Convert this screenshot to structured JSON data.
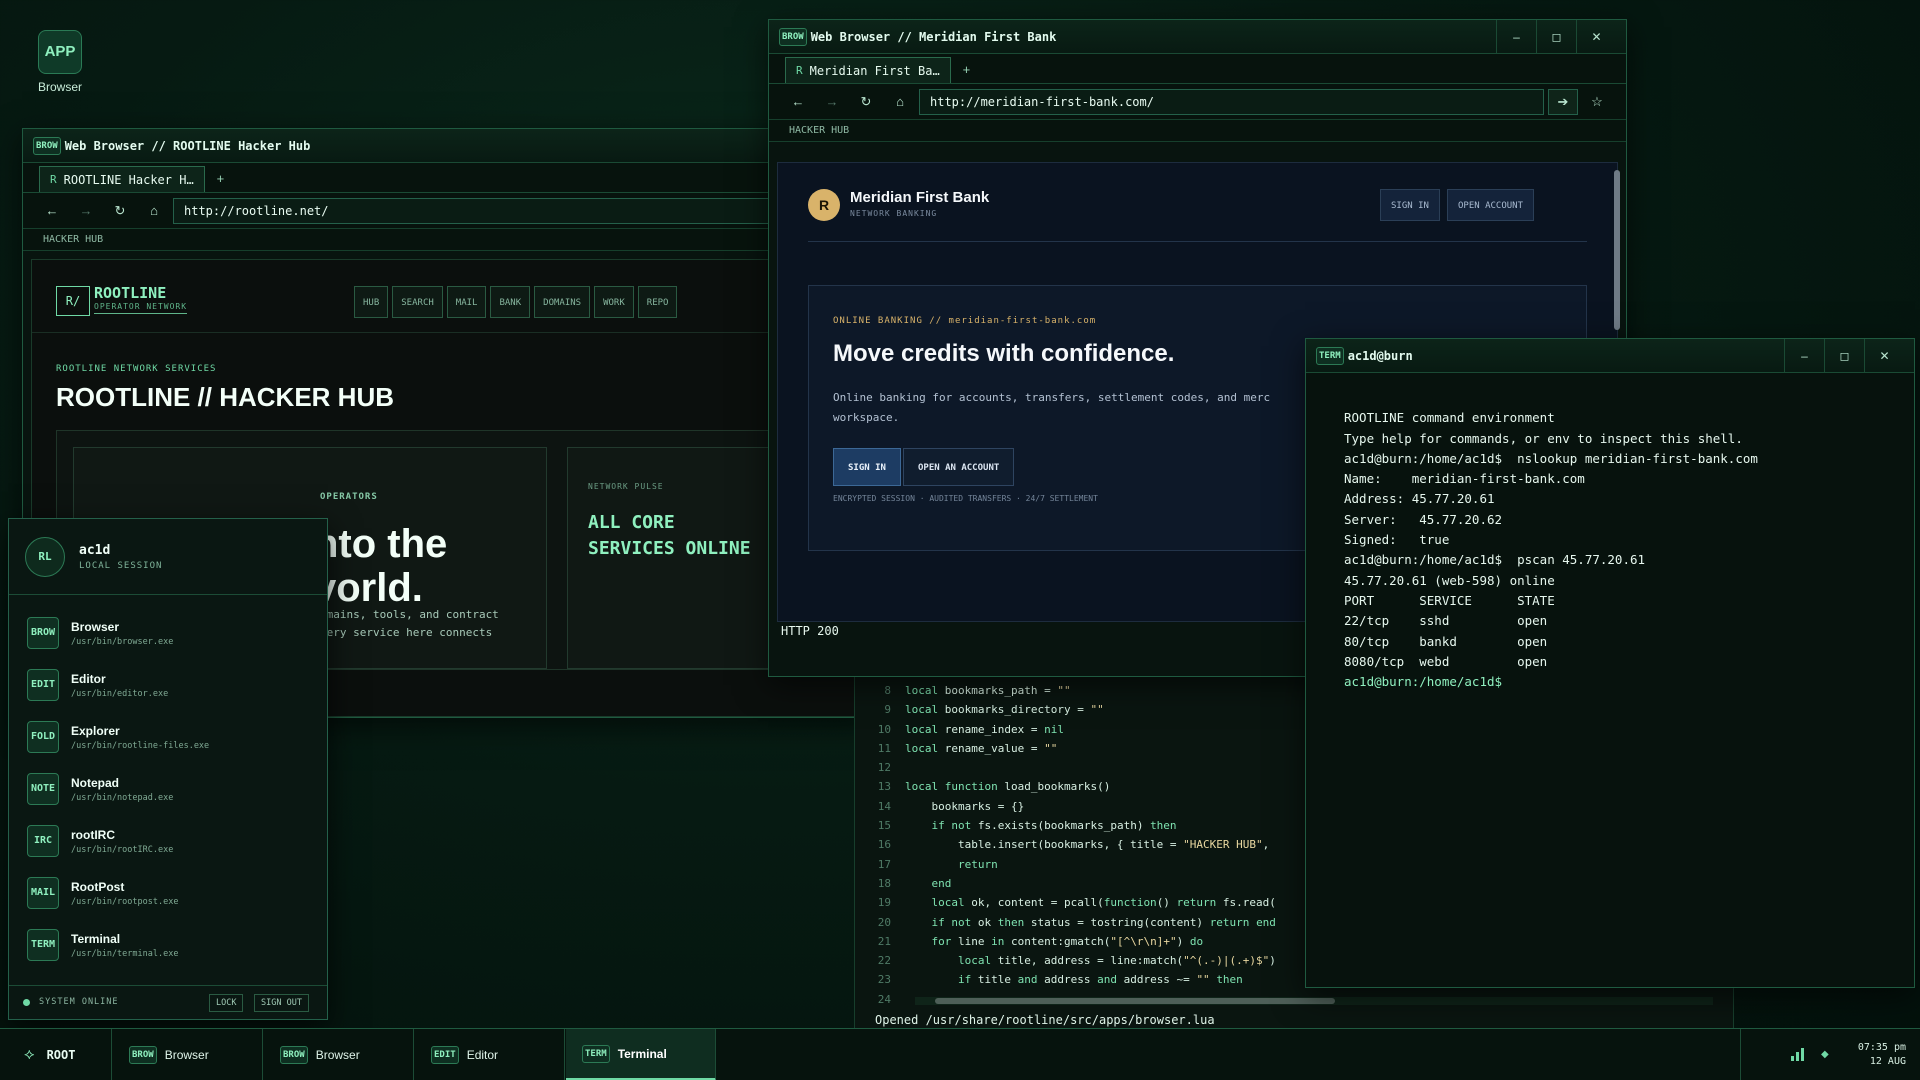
{
  "desktop": {
    "icon_tile": "APP",
    "icon_label": "Browser"
  },
  "rootline_window": {
    "badge": "BROW",
    "title": "Web Browser // ROOTLINE Hacker Hub",
    "tab_label": "ROOTLINE Hacker H…",
    "tab_icon": "R",
    "tab_add": "+",
    "url": "http://rootline.net/",
    "crumb": "HACKER HUB",
    "logo": "R/",
    "brand": "ROOTLINE",
    "brand_sub": "OPERATOR NETWORK",
    "nav": [
      "HUB",
      "SEARCH",
      "MAIL",
      "BANK",
      "DOMAINS",
      "WORK",
      "REPO"
    ],
    "kicker": "ROOTLINE NETWORK SERVICES",
    "heading": "ROOTLINE // HACKER HUB",
    "card_kicker": "OPERATORS",
    "card_big_1": "nto the",
    "card_big_2": "vorld.",
    "card_body_1": "omains, tools, and contract",
    "card_body_2": "very service here connects",
    "pulse_kicker": "NETWORK PULSE",
    "pulse_1": "ALL CORE",
    "pulse_2": "SERVICES ONLINE"
  },
  "bank_window": {
    "badge": "BROW",
    "title": "Web Browser // Meridian First Bank",
    "tab_label": "Meridian First Ba…",
    "tab_icon": "R",
    "tab_add": "+",
    "url": "http://meridian-first-bank.com/",
    "crumb": "HACKER HUB",
    "logo": "R",
    "name": "Meridian First Bank",
    "sub": "NETWORK BANKING",
    "sign_in": "SIGN IN",
    "open_account": "OPEN ACCOUNT",
    "kicker": "ONLINE BANKING // meridian-first-bank.com",
    "hero": "Move credits with confidence.",
    "desc_1": "Online banking for accounts, transfers, settlement codes, and merc",
    "desc_2": "workspace.",
    "cta_sign_in": "SIGN IN",
    "cta_open": "OPEN AN ACCOUNT",
    "fine": "ENCRYPTED SESSION · AUDITED TRANSFERS · 24/7 SETTLEMENT",
    "status": "HTTP 200"
  },
  "editor": {
    "lines": [
      {
        "n": "8",
        "code": "local bookmarks_path = \"\""
      },
      {
        "n": "9",
        "code": "local bookmarks_directory = \"\""
      },
      {
        "n": "10",
        "code": "local rename_index = nil"
      },
      {
        "n": "11",
        "code": "local rename_value = \"\""
      },
      {
        "n": "12",
        "code": ""
      },
      {
        "n": "13",
        "code": "local function load_bookmarks()"
      },
      {
        "n": "14",
        "code": "    bookmarks = {}"
      },
      {
        "n": "15",
        "code": "    if not fs.exists(bookmarks_path) then"
      },
      {
        "n": "16",
        "code": "        table.insert(bookmarks, { title = \"HACKER HUB\","
      },
      {
        "n": "17",
        "code": "        return"
      },
      {
        "n": "18",
        "code": "    end"
      },
      {
        "n": "19",
        "code": "    local ok, content = pcall(function() return fs.read("
      },
      {
        "n": "20",
        "code": "    if not ok then status = tostring(content) return end"
      },
      {
        "n": "21",
        "code": "    for line in content:gmatch(\"[^\\r\\n]+\") do"
      },
      {
        "n": "22",
        "code": "        local title, address = line:match(\"^(.-)|(.+)$\")"
      },
      {
        "n": "23",
        "code": "        if title and address and address ~= \"\" then"
      },
      {
        "n": "24",
        "code": ""
      }
    ],
    "status": "Opened /usr/share/rootline/src/apps/browser.lua"
  },
  "terminal": {
    "badge": "TERM",
    "title": "ac1d@burn",
    "lines": [
      "ROOTLINE command environment",
      "Type help for commands, or env to inspect this shell.",
      "ac1d@burn:/home/ac1d$  nslookup meridian-first-bank.com",
      "Name:    meridian-first-bank.com",
      "Address: 45.77.20.61",
      "Server:   45.77.20.62",
      "Signed:   true",
      "ac1d@burn:/home/ac1d$  pscan 45.77.20.61",
      "45.77.20.61 (web-598) online",
      "PORT      SERVICE      STATE",
      "22/tcp    sshd         open",
      "80/tcp    bankd        open",
      "8080/tcp  webd         open"
    ],
    "prompt": "ac1d@burn:/home/ac1d$"
  },
  "start_menu": {
    "avatar": "RL",
    "user": "ac1d",
    "session": "LOCAL SESSION",
    "items": [
      {
        "icon": "BROW",
        "name": "Browser",
        "path": "/usr/bin/browser.exe"
      },
      {
        "icon": "EDIT",
        "name": "Editor",
        "path": "/usr/bin/editor.exe"
      },
      {
        "icon": "FOLD",
        "name": "Explorer",
        "path": "/usr/bin/rootline-files.exe"
      },
      {
        "icon": "NOTE",
        "name": "Notepad",
        "path": "/usr/bin/notepad.exe"
      },
      {
        "icon": "IRC",
        "name": "rootIRC",
        "path": "/usr/bin/rootIRC.exe"
      },
      {
        "icon": "MAIL",
        "name": "RootPost",
        "path": "/usr/bin/rootpost.exe"
      },
      {
        "icon": "TERM",
        "name": "Terminal",
        "path": "/usr/bin/terminal.exe"
      }
    ],
    "status": "SYSTEM ONLINE",
    "lock": "LOCK",
    "sign_out": "SIGN OUT"
  },
  "taskbar": {
    "root": "ROOT",
    "tasks": [
      {
        "badge": "BROW",
        "label": "Browser"
      },
      {
        "badge": "BROW",
        "label": "Browser"
      },
      {
        "badge": "EDIT",
        "label": "Editor"
      },
      {
        "badge": "TERM",
        "label": "Terminal"
      }
    ],
    "time": "07:35 pm",
    "date": "12 AUG"
  },
  "window_controls": {
    "minimize": "–",
    "maximize": "◻",
    "close": "✕"
  }
}
